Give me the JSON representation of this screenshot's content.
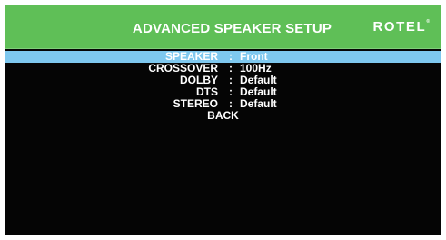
{
  "header": {
    "title": "ADVANCED SPEAKER SETUP",
    "brand": "ROTEL",
    "brand_mark": "®"
  },
  "menu": {
    "items": [
      {
        "label": "SPEAKER",
        "separator": ":",
        "value": "Front",
        "selected": true
      },
      {
        "label": "CROSSOVER",
        "separator": ":",
        "value": "100Hz",
        "selected": false
      },
      {
        "label": "DOLBY",
        "separator": ":",
        "value": "Default",
        "selected": false
      },
      {
        "label": "DTS",
        "separator": ":",
        "value": "Default",
        "selected": false
      },
      {
        "label": "STEREO",
        "separator": ":",
        "value": "Default",
        "selected": false
      }
    ],
    "back_label": "BACK"
  },
  "colors": {
    "header_bg": "#5fbf57",
    "selection_bg": "#7ec8ef",
    "screen_bg": "#050505",
    "text": "#ffffff"
  }
}
